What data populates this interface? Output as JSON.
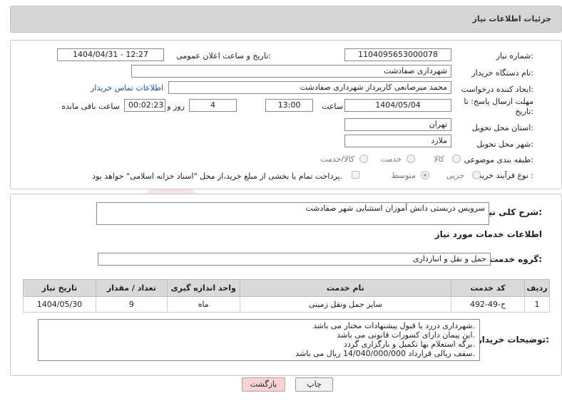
{
  "header": {
    "title": "جزئیات اطلاعات نیاز"
  },
  "form": {
    "need_number_label": "شماره نیاز:",
    "need_number": "1104095653000078",
    "announce_label": "تاریخ و ساعت اعلان عمومی:",
    "announce_value": "1404/04/31 - 12:27",
    "buyer_org_label": "نام دستگاه خریدار:",
    "buyer_org": "شهرداری صفادشت",
    "requester_label": "ایجاد کننده درخواست:",
    "requester": "محمد میرصانعی کارپرداز شهرداری صفادشت",
    "contact_link": "اطلاعات تماس خریدار",
    "deadline_label": "مهلت ارسال پاسخ: تا تاریخ:",
    "deadline_date": "1404/05/04",
    "time_label": "ساعت",
    "deadline_time": "13:00",
    "days_value": "4",
    "days_label": "روز و",
    "remaining_time": "00:02:23",
    "remaining_label": "ساعت باقی مانده",
    "province_label": "استان محل تحویل:",
    "province": "تهران",
    "city_label": "شهر محل تحویل:",
    "city": "ملارد",
    "category_label": "طبقه بندی موضوعی:",
    "category_options": [
      "کالا",
      "خدمت",
      "کالا/خدمت"
    ],
    "purchase_type_label": "نوع فرآیند خرید :",
    "purchase_type_options": [
      "جزیی",
      "متوسط"
    ],
    "payment_note": "پرداخت تمام یا بخشی از مبلغ خرید،از محل \"اسناد خزانه اسلامی\" خواهد بود."
  },
  "summary": {
    "description_label": "شرح کلی نیاز:",
    "description": "سرویس دربستی دانش آموزان استثنایی شهر صفادشت",
    "services_title": "اطلاعات خدمات مورد نیاز",
    "group_label": "گروه خدمت:",
    "group_value": "حمل و نقل و انبارداری"
  },
  "table": {
    "headers": [
      "ردیف",
      "کد خدمت",
      "نام خدمت",
      "واحد اندازه گیری",
      "تعداد / مقدار",
      "تاریخ نیاز"
    ],
    "rows": [
      [
        "1",
        "ح-49-492",
        "سایر حمل ونقل زمینی",
        "ماه",
        "9",
        "1404/05/30"
      ]
    ]
  },
  "buyer_notes": {
    "label": "توضیحات خریدار:",
    "lines": [
      "شهرداری دررد یا قبول پیشنهادات مختار می باشد.",
      "این پیمان دارای کسورات قانونی می باشد.",
      "برگه استعلام بها تکمیل و بارگزاری گردد.",
      "سقف ریالی قرارداد 14/040/000/000 ریال می باشد."
    ]
  },
  "buttons": {
    "print": "چاپ",
    "back": "بازگشت"
  },
  "watermark": {
    "text": "AriaTender.neT"
  },
  "colors": {
    "header_bg": "#d6d6d6",
    "link": "#1a4fa8",
    "back_button": "#f7d4d4",
    "watermark": "#c0392b"
  }
}
